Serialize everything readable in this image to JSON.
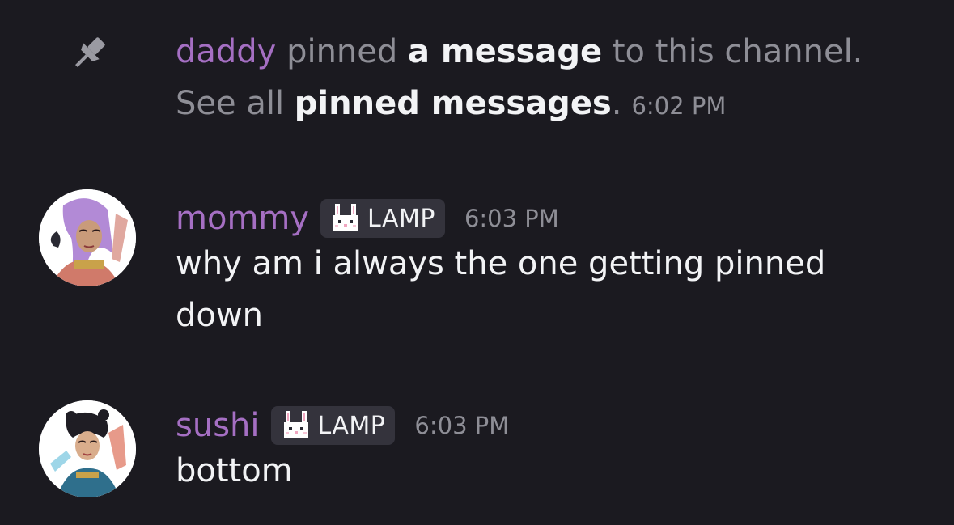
{
  "colors": {
    "background": "#1b1a20",
    "username": "#a56fc3",
    "muted": "#8e8e96",
    "text": "#f2f3f5",
    "tag_bg": "#34333c"
  },
  "system_message": {
    "icon": "pin-icon",
    "actor": "daddy",
    "pinned_text": " pinned ",
    "link_text": "a message",
    "channel_text": " to this channel.",
    "see_all_text": "See all ",
    "pinned_link": "pinned messages",
    "period": ".",
    "time": "6:02 PM"
  },
  "messages": [
    {
      "author": "mommy",
      "avatar": "avatar",
      "role_icon": "bunny-icon",
      "role": "LAMP",
      "time": "6:03 PM",
      "text": "why am i always the one getting pinned down"
    },
    {
      "author": "sushi",
      "avatar": "avatar",
      "role_icon": "bunny-icon",
      "role": "LAMP",
      "time": "6:03 PM",
      "text": "bottom"
    }
  ]
}
